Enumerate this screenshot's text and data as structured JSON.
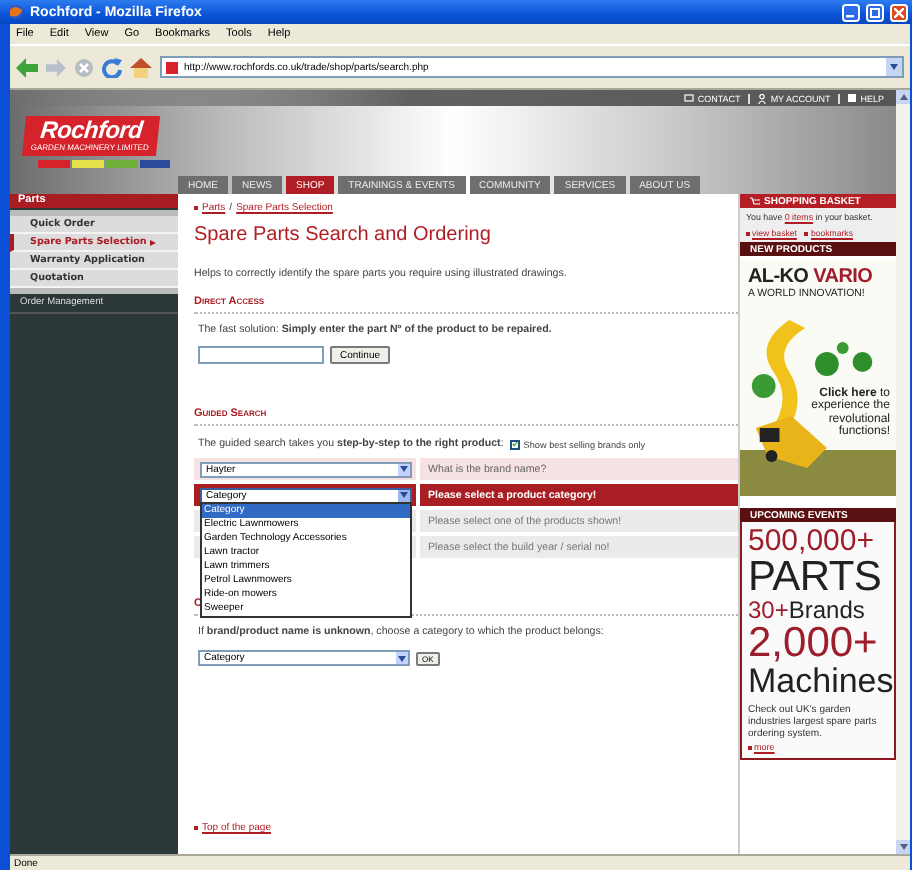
{
  "window": {
    "title": "Rochford - Mozilla Firefox"
  },
  "menu": [
    "File",
    "Edit",
    "View",
    "Go",
    "Bookmarks",
    "Tools",
    "Help"
  ],
  "address": "http://www.rochfords.co.uk/trade/shop/parts/search.php",
  "top_links": [
    "CONTACT",
    "MY ACCOUNT",
    "HELP"
  ],
  "logo": {
    "name": "Rochford",
    "tagline": "GARDEN MACHINERY LIMITED"
  },
  "nav": [
    {
      "label": "HOME",
      "selected": false
    },
    {
      "label": "NEWS",
      "selected": false
    },
    {
      "label": "SHOP",
      "selected": true
    },
    {
      "label": "TRAININGS & EVENTS",
      "selected": false
    },
    {
      "label": "COMMUNITY",
      "selected": false
    },
    {
      "label": "SERVICES",
      "selected": false
    },
    {
      "label": "ABOUT US",
      "selected": false
    }
  ],
  "sidebar": {
    "title": "Parts",
    "items": [
      {
        "label": "Quick Order",
        "selected": false
      },
      {
        "label": "Spare Parts Selection",
        "selected": true
      },
      {
        "label": "Warranty Application",
        "selected": false
      },
      {
        "label": "Quotation",
        "selected": false
      }
    ],
    "footer": "Order Management"
  },
  "breadcrumb": {
    "items": [
      "Parts",
      "Spare Parts Selection"
    ],
    "separator": "/"
  },
  "heading": "Spare Parts Search and Ordering",
  "intro": "Helps to correctly identify the spare parts you require using illustrated drawings.",
  "direct_access": {
    "title": "Direct Access",
    "text": "The fast solution: **Simply enter the part Nº of the product to be repaired.**",
    "button": "Continue"
  },
  "guided_search": {
    "title": "Guided Search",
    "text": "The guided search takes you **step-by-step to the right product**:",
    "checkbox": {
      "label": "Show best selling brands only",
      "checked": true
    },
    "steps": [
      {
        "value": "Hayter",
        "hint": "What is the brand name?",
        "kind": "done",
        "expanded": false
      },
      {
        "value": "Category",
        "hint": "Please select a product category!",
        "kind": "active",
        "expanded": true,
        "options": [
          {
            "label": "Category",
            "selected": true
          },
          {
            "label": "Electric Lawnmowers",
            "selected": false
          },
          {
            "label": "Garden Technology Accessories",
            "selected": false
          },
          {
            "label": "Lawn tractor",
            "selected": false
          },
          {
            "label": "Lawn trimmers",
            "selected": false
          },
          {
            "label": "Petrol Lawnmowers",
            "selected": false
          },
          {
            "label": "Ride-on mowers",
            "selected": false
          },
          {
            "label": "Sweeper",
            "selected": false
          }
        ]
      },
      {
        "hint": "Please select one of the products shown!",
        "kind": "pending"
      },
      {
        "hint": "Please select the build year / serial no!",
        "kind": "pending"
      }
    ]
  },
  "category_search": {
    "title": "C",
    "text": "If **brand/product name is unknown**, choose a category to which the product belongs:",
    "select": "Category",
    "button": "OK"
  },
  "top_link": "Top of the page",
  "basket": {
    "title": "SHOPPING BASKET",
    "before": "You have ",
    "link": "0 items",
    "after": " in your basket.",
    "links": [
      "view basket",
      "bookmarks"
    ]
  },
  "new_products": {
    "title": "NEW PRODUCTS",
    "brand": "AL-KO",
    "model": "VARIO",
    "tagline": "A WORLD INNOVATION!",
    "cta": "**Click here** to experience the revolutional functions!"
  },
  "events": {
    "title": "UPCOMING EVENTS",
    "lines": [
      {
        "kind": "m",
        "parts": [
          {
            "text": "500,000+",
            "color": "#9c1d2b"
          }
        ]
      },
      {
        "kind": "xl",
        "parts": [
          {
            "text": "PARTS",
            "color": "#1e2222"
          }
        ]
      },
      {
        "kind": "s",
        "parts": [
          {
            "text": "30+",
            "color": "#9c1d2b"
          },
          {
            "text": "Brands",
            "color": "#1e2222"
          }
        ]
      },
      {
        "kind": "l",
        "parts": [
          {
            "text": "2,000+",
            "color": "#9c1d2b"
          }
        ]
      },
      {
        "kind": "ml",
        "parts": [
          {
            "text": "Machines",
            "color": "#1e2222"
          }
        ]
      }
    ],
    "text": "Check out UK's garden industries largest spare parts ordering system.",
    "link": "more"
  },
  "status_bar": "Done"
}
